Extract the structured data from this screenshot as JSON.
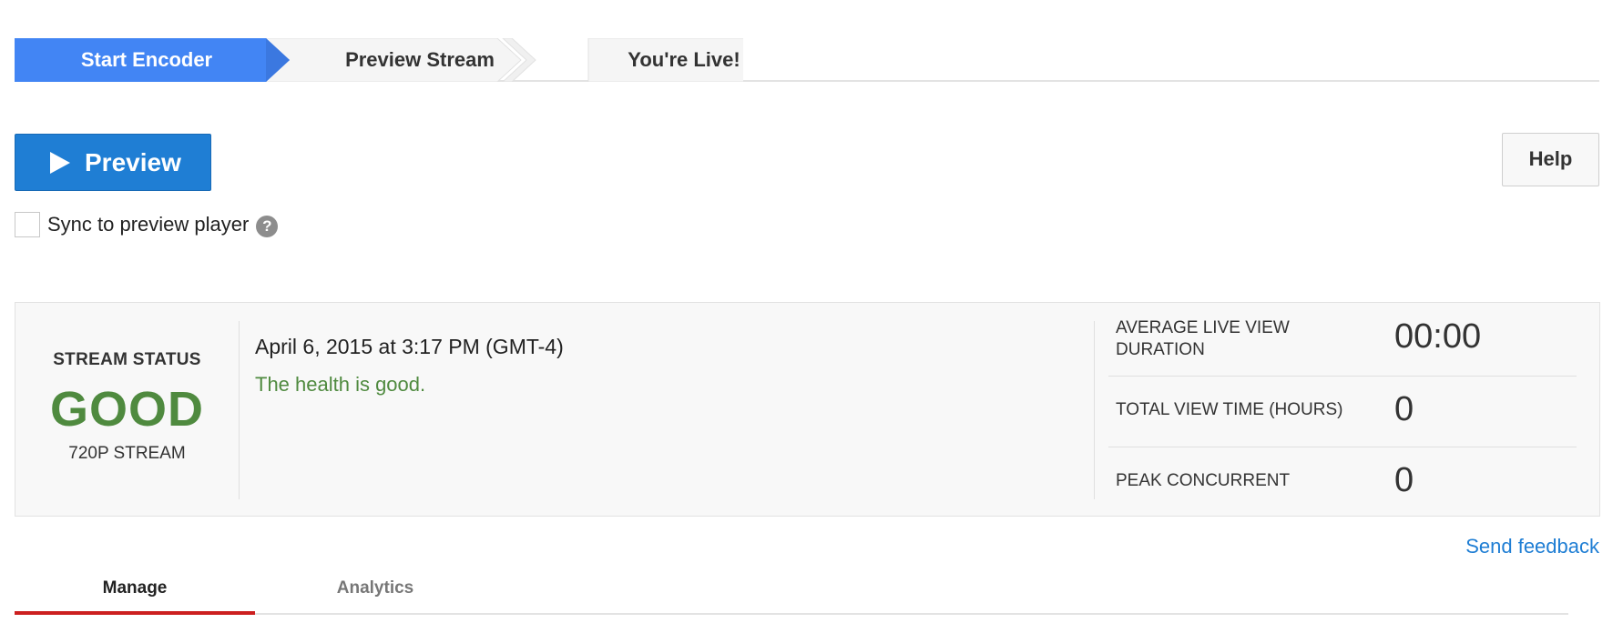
{
  "steps": [
    {
      "label": "Start Encoder",
      "active": true
    },
    {
      "label": "Preview Stream",
      "active": false
    },
    {
      "label": "You're Live!",
      "active": false
    }
  ],
  "toolbar": {
    "preview_label": "Preview",
    "help_label": "Help"
  },
  "sync": {
    "label": "Sync to preview player",
    "checked": false,
    "help_glyph": "?"
  },
  "status": {
    "title": "STREAM STATUS",
    "value": "GOOD",
    "resolution": "720P STREAM",
    "timestamp": "April 6, 2015 at 3:17 PM (GMT-4)",
    "message": "The health is good."
  },
  "metrics": [
    {
      "label": "AVERAGE LIVE VIEW DURATION",
      "value": "00:00"
    },
    {
      "label": "TOTAL VIEW TIME (HOURS)",
      "value": "0"
    },
    {
      "label": "PEAK CONCURRENT",
      "value": "0"
    }
  ],
  "feedback_label": "Send feedback",
  "tabs": [
    {
      "label": "Manage",
      "active": true
    },
    {
      "label": "Analytics",
      "active": false
    }
  ],
  "colors": {
    "accent": "#4285f4",
    "primary_button": "#1f7ed4",
    "good": "#4f8a3f",
    "tab_underline": "#cc1f1f",
    "link": "#1f7ed4"
  }
}
